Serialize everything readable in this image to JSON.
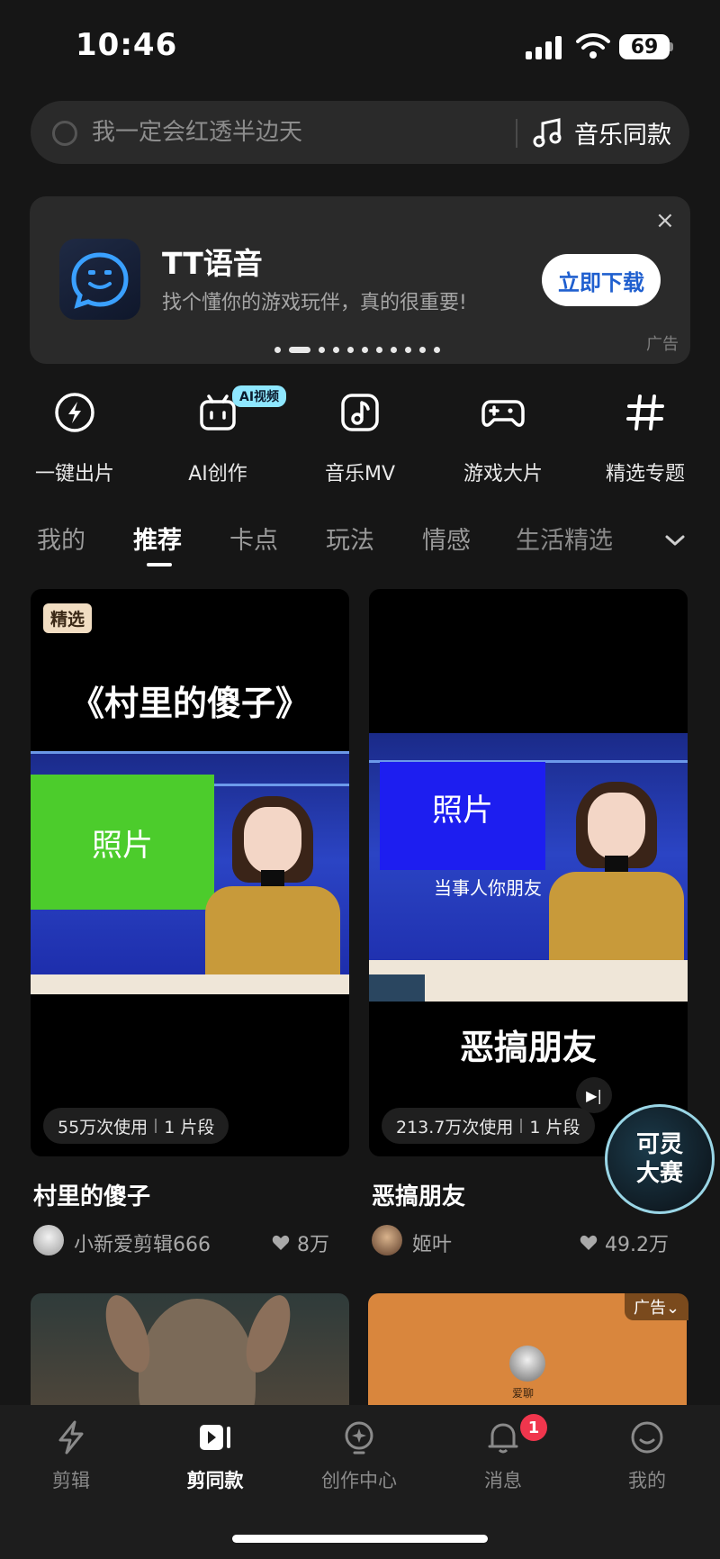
{
  "status": {
    "time": "10:46",
    "battery": "69"
  },
  "search": {
    "placeholder": "我一定会红透半边天",
    "music_label": "音乐同款"
  },
  "ad_banner": {
    "title": "TT语音",
    "subtitle": "找个懂你的游戏玩伴，真的很重要!",
    "button": "立即下载",
    "tag": "广告",
    "close": "×"
  },
  "quick_actions": [
    {
      "label": "一键出片",
      "icon": "lightning-icon"
    },
    {
      "label": "AI创作",
      "icon": "robot-icon"
    },
    {
      "label": "音乐MV",
      "icon": "music-note-icon"
    },
    {
      "label": "游戏大片",
      "icon": "gamepad-icon"
    },
    {
      "label": "精选专题",
      "icon": "hashtag-icon"
    }
  ],
  "ai_badge": "AI视频",
  "tabs": [
    "我的",
    "推荐",
    "卡点",
    "玩法",
    "情感",
    "生活精选"
  ],
  "active_tab": "推荐",
  "cards": [
    {
      "badge": "精选",
      "overlay_title": "《村里的傻子》",
      "photo_label": "照片",
      "usage": "55万次使用",
      "segments": "1 片段",
      "name": "村里的傻子",
      "author": "小新爱剪辑666",
      "likes": "8万"
    },
    {
      "photo_label": "照片",
      "caption": "当事人你朋友",
      "bottom_title": "恶搞朋友",
      "usage": "213.7万次使用",
      "segments": "1 片段",
      "name": "恶搞朋友",
      "author": "姬叶",
      "likes": "49.2万"
    }
  ],
  "keling": {
    "line1": "可灵",
    "line2": "大赛"
  },
  "second_row": {
    "ad_chip": "广告⌄",
    "avatar_label": "爱聊"
  },
  "bottom_nav": [
    {
      "label": "剪辑",
      "icon": "lightning-icon"
    },
    {
      "label": "剪同款",
      "icon": "template-play-icon"
    },
    {
      "label": "创作中心",
      "icon": "bulb-icon"
    },
    {
      "label": "消息",
      "icon": "bell-icon"
    },
    {
      "label": "我的",
      "icon": "profile-icon"
    }
  ],
  "active_nav": "剪同款",
  "notification_count": "1",
  "colors": {
    "background": "#161616",
    "accent_blue": "#1f5fcf",
    "badge_red": "#f0364d"
  }
}
